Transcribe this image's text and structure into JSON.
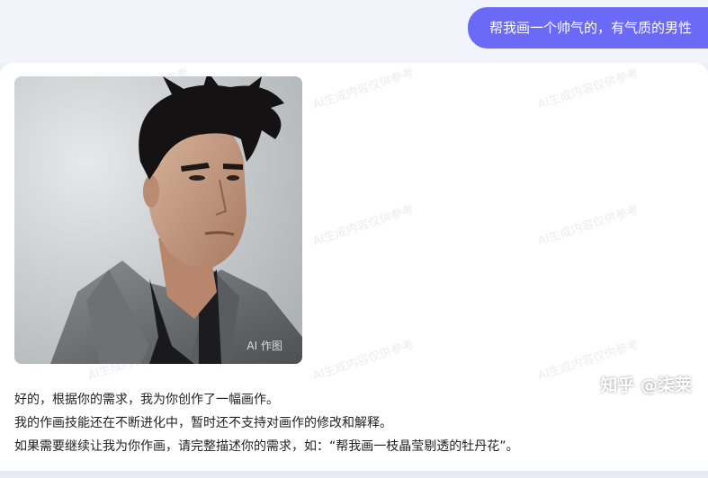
{
  "conversation": {
    "user_message": "帮我画一个帅气的，有气质的男性",
    "assistant": {
      "image_badge": "AI 作图",
      "watermark_text": "AI生成内容仅供参考",
      "reply_lines": [
        "好的，根据你的需求，我为你创作了一幅画作。",
        "我的作画技能还在不断进化中，暂时还不支持对画作的修改和解释。",
        "如果需要继续让我为你作画，请完整描述你的需求，如：“帮我画一枝晶莹剔透的牡丹花”。"
      ]
    }
  },
  "overlay": {
    "site_watermark": "知乎 @柒莱"
  },
  "colors": {
    "user_bubble": "#6b6af7",
    "page_background": "#eef0f8",
    "card_background": "#ffffff"
  },
  "icons": {
    "portrait": "generated-portrait-image"
  }
}
